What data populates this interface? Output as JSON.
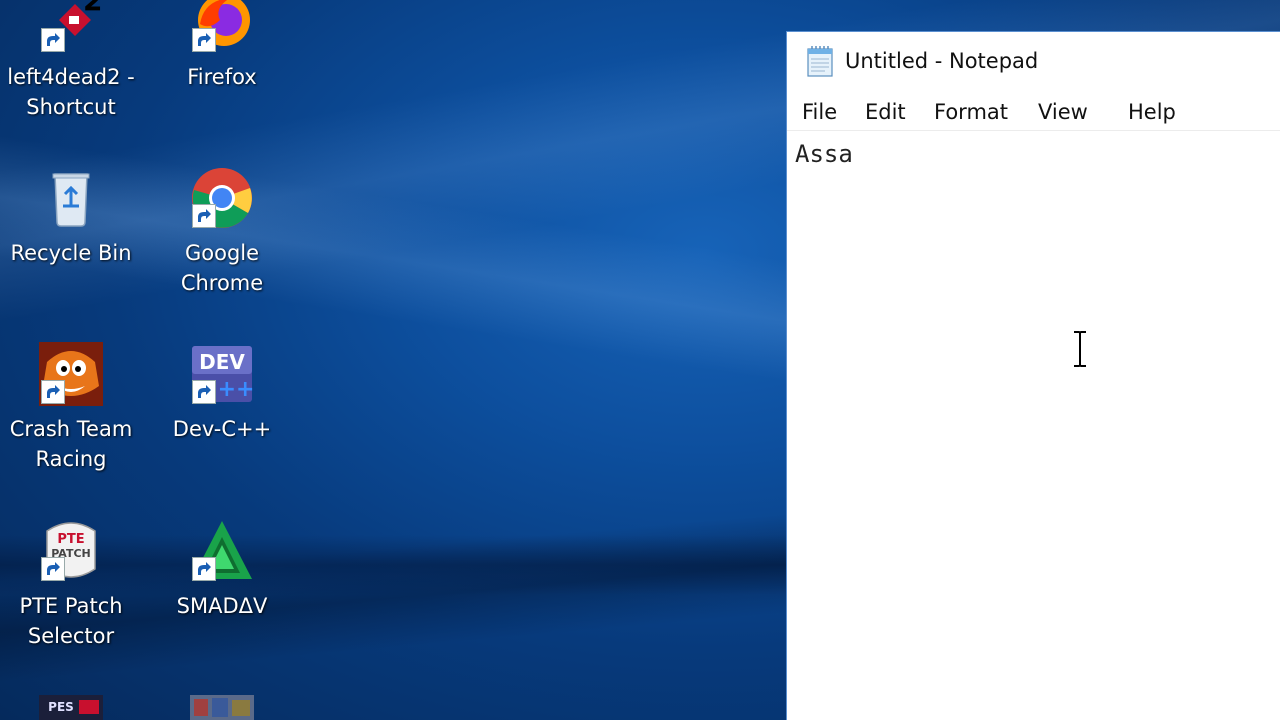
{
  "desktop": {
    "icons": [
      {
        "label": "left4dead2 - Shortcut",
        "label_line1": "left4dead2 -",
        "label_line2": "Shortcut",
        "icon": "left4dead2-icon"
      },
      {
        "label": "Firefox",
        "label_line1": "Firefox",
        "label_line2": "",
        "icon": "firefox-icon"
      },
      {
        "label": "Recycle Bin",
        "label_line1": "Recycle Bin",
        "label_line2": "",
        "icon": "recycle-bin-icon"
      },
      {
        "label": "Google Chrome",
        "label_line1": "Google",
        "label_line2": "Chrome",
        "icon": "chrome-icon"
      },
      {
        "label": "Crash Team Racing",
        "label_line1": "Crash Team",
        "label_line2": "Racing",
        "icon": "crash-team-racing-icon"
      },
      {
        "label": "Dev-C++",
        "label_line1": "Dev-C++",
        "label_line2": "",
        "icon": "dev-cpp-icon"
      },
      {
        "label": "PTE Patch Selector",
        "label_line1": "PTE Patch",
        "label_line2": "Selector",
        "icon": "pte-patch-icon"
      },
      {
        "label": "SMADAV",
        "label_line1": "SMADΔV",
        "label_line2": "",
        "icon": "smadav-icon"
      }
    ],
    "icon_texts": {
      "dev": "DEV",
      "dev_plus": "++",
      "pte_top": "PTE",
      "pte_bottom": "PATCH",
      "pes": "PES"
    }
  },
  "notepad": {
    "title": "Untitled - Notepad",
    "menu": [
      "File",
      "Edit",
      "Format",
      "View",
      "Help"
    ],
    "content": "Assa"
  },
  "colors": {
    "desktop_blue": "#0d4f9e",
    "window_border": "#5a8fd0",
    "text_dark": "#111111"
  }
}
